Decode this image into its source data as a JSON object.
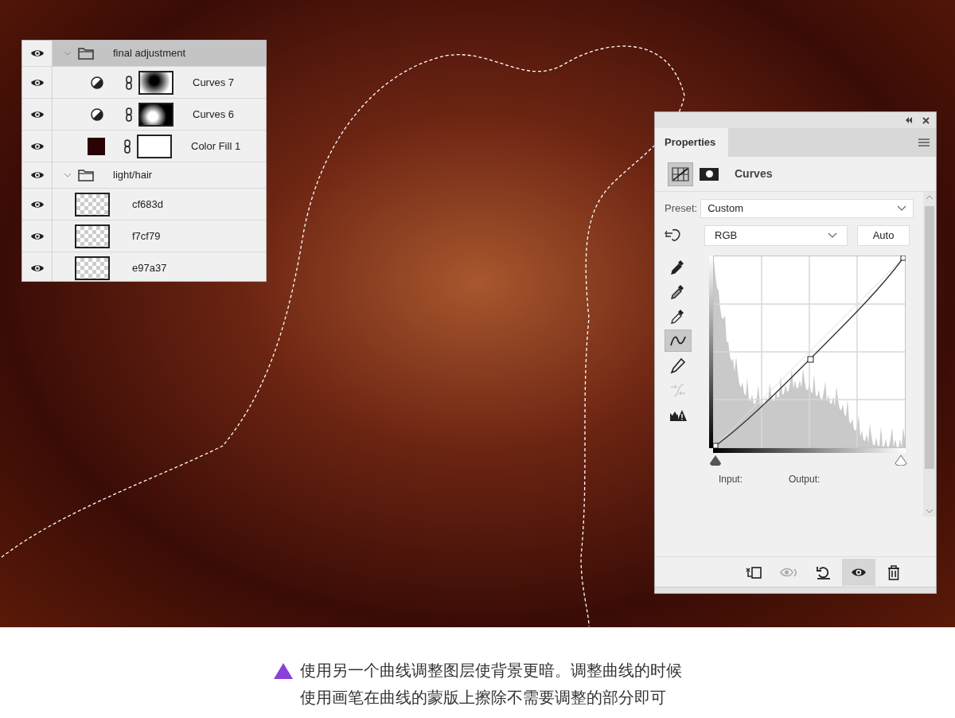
{
  "layers_panel": {
    "layers": [
      {
        "name": "final adjustment",
        "kind": "group",
        "visible": true,
        "selected": true,
        "expanded": true,
        "children": [
          {
            "name": "Curves 7",
            "kind": "curves",
            "visible": true,
            "selected": false
          },
          {
            "name": "Curves 6",
            "kind": "curves",
            "visible": true,
            "selected": false
          },
          {
            "name": "Color Fill 1",
            "kind": "fill",
            "visible": true,
            "selected": false
          }
        ]
      },
      {
        "name": "light/hair",
        "kind": "group",
        "visible": true,
        "selected": false,
        "expanded": true,
        "children": [
          {
            "name": "cf683d",
            "kind": "pixel",
            "visible": true,
            "selected": false
          },
          {
            "name": "f7cf79",
            "kind": "pixel",
            "visible": true,
            "selected": false
          },
          {
            "name": "e97a37",
            "kind": "pixel",
            "visible": true,
            "selected": false
          }
        ]
      }
    ]
  },
  "properties_panel": {
    "tab": "Properties",
    "title": "Curves",
    "preset": {
      "label": "Preset:",
      "value": "Custom"
    },
    "channel": "RGB",
    "auto_button": "Auto",
    "tools": [
      {
        "kind": "black-point",
        "selected": false,
        "disabled": false
      },
      {
        "kind": "gray-point",
        "selected": false,
        "disabled": false
      },
      {
        "kind": "white-point",
        "selected": false,
        "disabled": false
      },
      {
        "kind": "curve",
        "selected": true,
        "disabled": false
      },
      {
        "kind": "pencil",
        "selected": false,
        "disabled": false
      },
      {
        "kind": "smooth",
        "selected": false,
        "disabled": true
      },
      {
        "kind": "clipping",
        "selected": false,
        "disabled": false
      }
    ],
    "input_label": "Input:",
    "output_label": "Output:",
    "footer_buttons": [
      {
        "kind": "clip",
        "selected": false,
        "disabled": false
      },
      {
        "kind": "previous",
        "selected": false,
        "disabled": true
      },
      {
        "kind": "reset",
        "selected": false,
        "disabled": false
      },
      {
        "kind": "visibility",
        "selected": true,
        "disabled": false
      },
      {
        "kind": "delete",
        "selected": false,
        "disabled": false
      }
    ]
  },
  "caption": {
    "lines": [
      "使用另一个曲线调整图层使背景更暗。调整曲线的时候",
      "使用画笔在曲线的蒙版上擦除不需要调整的部分即可"
    ]
  }
}
